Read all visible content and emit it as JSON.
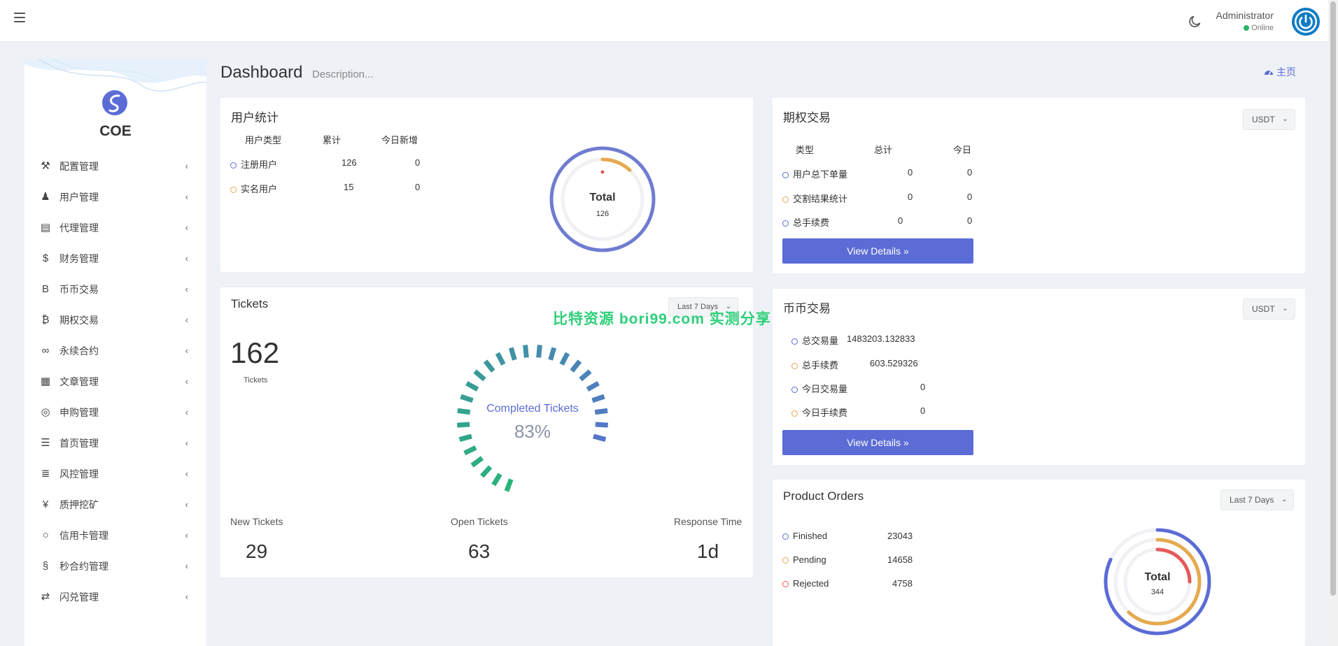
{
  "header": {
    "user_name": "Administrator",
    "user_status": "Online"
  },
  "sidebar": {
    "brand": "COE",
    "items": [
      {
        "label": "配置管理",
        "icon": "wrench-icon"
      },
      {
        "label": "用户管理",
        "icon": "user-tie-icon"
      },
      {
        "label": "代理管理",
        "icon": "id-card-icon"
      },
      {
        "label": "财务管理",
        "icon": "dollar-icon"
      },
      {
        "label": "币币交易",
        "icon": "bold-b-icon"
      },
      {
        "label": "期权交易",
        "icon": "bitcoin-icon"
      },
      {
        "label": "永续合约",
        "icon": "link-icon"
      },
      {
        "label": "文章管理",
        "icon": "newspaper-icon"
      },
      {
        "label": "申购管理",
        "icon": "lifebuoy-icon"
      },
      {
        "label": "首页管理",
        "icon": "bars-icon"
      },
      {
        "label": "风控管理",
        "icon": "indent-icon"
      },
      {
        "label": "质押挖矿",
        "icon": "yen-icon"
      },
      {
        "label": "信用卡管理",
        "icon": "circle-icon"
      },
      {
        "label": "秒合约管理",
        "icon": "coins-icon"
      },
      {
        "label": "闪兑管理",
        "icon": "exchange-icon"
      }
    ]
  },
  "page": {
    "title": "Dashboard",
    "description": "Description...",
    "home_link": "主页"
  },
  "user_stats": {
    "title": "用户统计",
    "headers": [
      "用户类型",
      "累计",
      "今日新增"
    ],
    "rows": [
      {
        "type": "注册用户",
        "total": "126",
        "today": "0",
        "color": "#5b6cd6"
      },
      {
        "type": "实名用户",
        "total": "15",
        "today": "0",
        "color": "#e5a94e"
      }
    ],
    "donut_label": "Total",
    "donut_value": "126",
    "donut_outer_fraction": 1.0,
    "donut_inner_fraction": 0.12
  },
  "options_trading": {
    "title": "期权交易",
    "currency": "USDT",
    "headers": [
      "类型",
      "总计",
      "今日"
    ],
    "rows": [
      {
        "type": "用户总下单量",
        "total": "0",
        "today": "0",
        "color": "#5b6cd6"
      },
      {
        "type": "交割结果统计",
        "total": "0",
        "today": "0",
        "color": "#e5a94e"
      },
      {
        "type": "总手续费",
        "total": "0",
        "today": "0",
        "color": "#5b6cd6"
      }
    ],
    "button": "View Details"
  },
  "tickets": {
    "title": "Tickets",
    "range": "Last 7 Days",
    "count": "162",
    "count_label": "Tickets",
    "gauge_title": "Completed Tickets",
    "gauge_value": "83%",
    "gauge_fraction": 0.83,
    "stats": [
      {
        "label": "New Tickets",
        "value": "29"
      },
      {
        "label": "Open Tickets",
        "value": "63"
      },
      {
        "label": "Response Time",
        "value": "1d"
      }
    ],
    "watermark": "比特资源 bori99.com 实测分享"
  },
  "spot_trading": {
    "title": "币币交易",
    "currency": "USDT",
    "rows": [
      {
        "label": "总交易量",
        "value": "1483203.132833",
        "color": "#5b6cd6"
      },
      {
        "label": "总手续费",
        "value": "603.529326",
        "color": "#e5a94e"
      },
      {
        "label": "今日交易量",
        "value": "0",
        "color": "#5b6cd6"
      },
      {
        "label": "今日手续费",
        "value": "0",
        "color": "#e5a94e"
      }
    ],
    "button": "View Details"
  },
  "product_orders": {
    "title": "Product Orders",
    "range": "Last 7 Days",
    "rows": [
      {
        "label": "Finished",
        "value": "23043",
        "color": "#5b6cd6",
        "fraction": 0.82
      },
      {
        "label": "Pending",
        "value": "14658",
        "color": "#e5a94e",
        "fraction": 0.62
      },
      {
        "label": "Rejected",
        "value": "4758",
        "color": "#e65a5a",
        "fraction": 0.25
      }
    ],
    "donut_label": "Total",
    "donut_value": "344"
  },
  "colors": {
    "primary": "#5b6cd6",
    "orange": "#e5a94e",
    "red": "#e65a5a",
    "green": "#28b463"
  }
}
